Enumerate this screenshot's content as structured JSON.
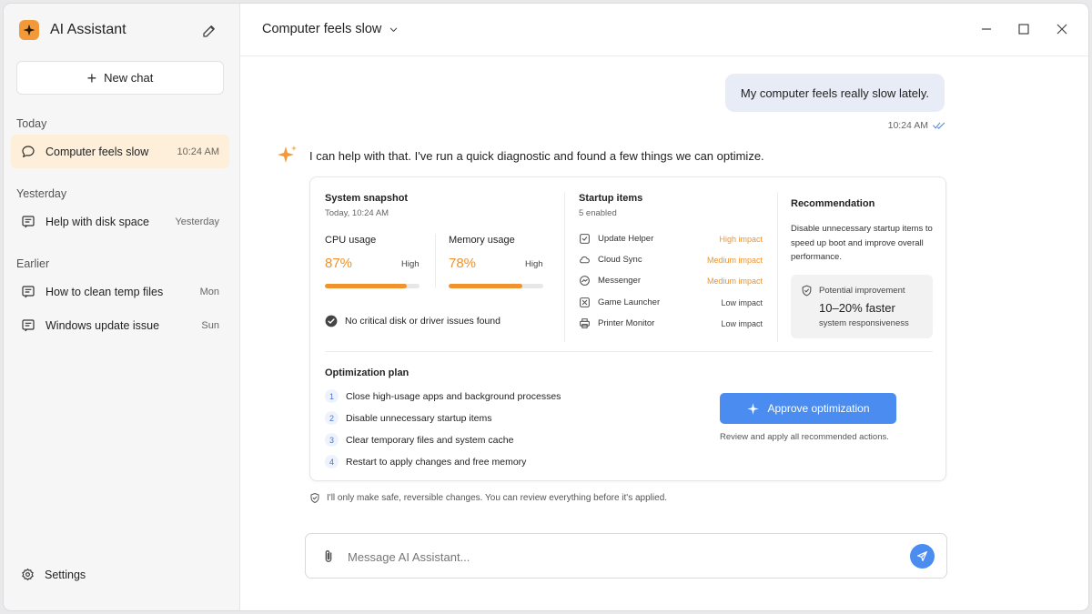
{
  "app": {
    "title": "AI Assistant",
    "accent_color": "#f29a3a",
    "icon": "sparkle-icon"
  },
  "sidebar": {
    "new_chat_label": "New chat",
    "sections": [
      {
        "label": "Today",
        "items": [
          {
            "label": "Computer feels slow",
            "time": "10:24 AM",
            "active": true,
            "icon": "chat-bubble-icon"
          }
        ]
      },
      {
        "label": "Yesterday",
        "items": [
          {
            "label": "Help with disk space",
            "time": "Yesterday",
            "icon": "chat-lines-icon"
          }
        ]
      },
      {
        "label": "Earlier",
        "items": [
          {
            "label": "How to clean temp files",
            "time": "Mon",
            "icon": "chat-lines-icon"
          },
          {
            "label": "Windows update issue",
            "time": "Sun",
            "icon": "chat-lines-icon"
          }
        ]
      }
    ],
    "settings_label": "Settings"
  },
  "conversation": {
    "title": "Computer feels slow",
    "user_message": "My computer feels really slow lately.",
    "user_message_time": "10:24 AM",
    "assistant_message": "I can help with that. I've run a quick diagnostic and found a few things we can optimize."
  },
  "snapshot": {
    "title": "System snapshot",
    "subtitle": "Today, 10:24 AM",
    "cpu": {
      "label": "CPU usage",
      "value": "87%",
      "level": "High",
      "percent": 87
    },
    "memory": {
      "label": "Memory usage",
      "value": "78%",
      "level": "High",
      "percent": 78
    },
    "status": "No critical disk or driver issues found"
  },
  "startup": {
    "title": "Startup items",
    "subtitle": "5 enabled",
    "items": [
      {
        "name": "Update Helper",
        "impact": "High impact",
        "color": "#f0922d",
        "icon": "update-icon"
      },
      {
        "name": "Cloud Sync",
        "impact": "Medium impact",
        "color": "#f0922d",
        "icon": "cloud-icon"
      },
      {
        "name": "Messenger",
        "impact": "Medium impact",
        "color": "#f0922d",
        "icon": "messenger-icon"
      },
      {
        "name": "Game Launcher",
        "impact": "Low impact",
        "color": "#444444",
        "icon": "gamepad-icon"
      },
      {
        "name": "Printer Monitor",
        "impact": "Low impact",
        "color": "#444444",
        "icon": "printer-icon"
      }
    ]
  },
  "recommendation": {
    "title": "Recommendation",
    "text": "Disable unnecessary startup items to speed up boot and improve overall performance.",
    "improvement_label": "Potential improvement",
    "improvement_value": "10–20% faster",
    "improvement_sub": "system responsiveness"
  },
  "plan": {
    "title": "Optimization plan",
    "steps": [
      {
        "num": "1",
        "text": "Close high-usage apps and background processes"
      },
      {
        "num": "2",
        "text": "Disable unnecessary startup items"
      },
      {
        "num": "3",
        "text": "Clear temporary files and system cache"
      },
      {
        "num": "4",
        "text": "Restart to apply changes and free memory"
      }
    ],
    "approve_label": "Approve optimization",
    "approve_hint": "Review and apply all recommended actions."
  },
  "safety_note": "I'll only make safe, reversible changes. You can review everything before it's applied.",
  "composer": {
    "placeholder": "Message AI Assistant...",
    "value": ""
  },
  "colors": {
    "accent_orange": "#f0922d",
    "primary_blue": "#4a8cf0",
    "active_item_bg": "#fdefd9",
    "user_bubble_bg": "#e7ecf7"
  }
}
